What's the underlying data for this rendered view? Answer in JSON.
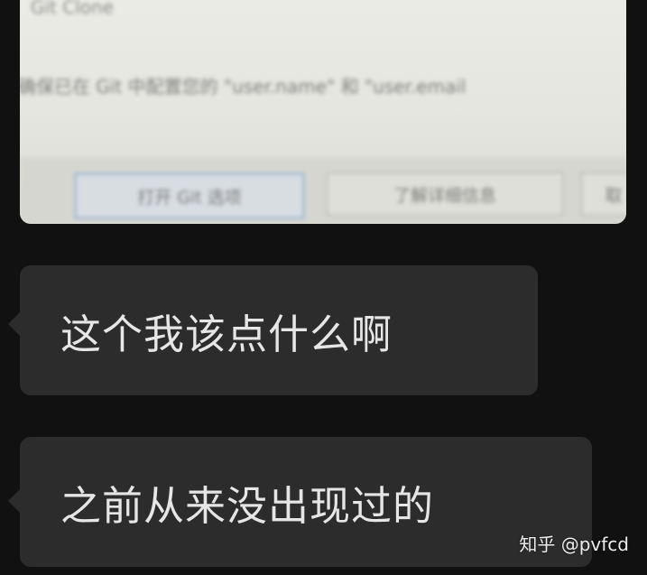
{
  "photo": {
    "top_text": "Git Clone",
    "message_text": "确保已在 Git 中配置您的 \"user.name\" 和 \"user.email",
    "buttons": {
      "primary_label": "打开 Git 选项",
      "secondary_label": "了解详细信息",
      "third_label": "取"
    }
  },
  "messages": [
    {
      "text": "这个我该点什么啊"
    },
    {
      "text": "之前从来没出现过的"
    }
  ],
  "watermark": "知乎 @pvfcd",
  "colors": {
    "background": "#111111",
    "bubble": "#2c2c2c",
    "bubble_text": "#e6e6e6"
  }
}
